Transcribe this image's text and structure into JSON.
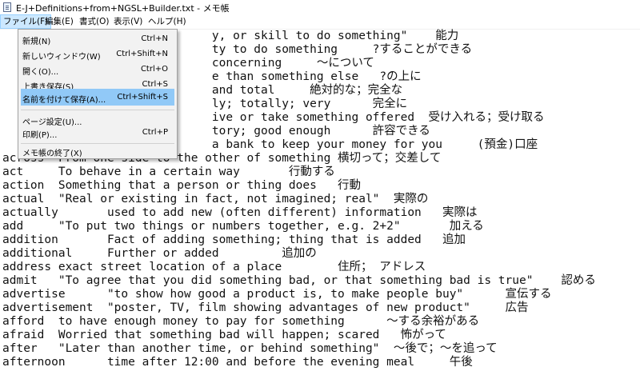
{
  "window": {
    "title": "E-J+Definitions+from+NGSL+Builder.txt - メモ帳"
  },
  "menubar": [
    {
      "label": "ファイル(F)",
      "active": true
    },
    {
      "label": "編集(E)"
    },
    {
      "label": "書式(O)"
    },
    {
      "label": "表示(V)"
    },
    {
      "label": "ヘルプ(H)"
    }
  ],
  "file_menu": {
    "groups": [
      [
        {
          "label": "新規(N)",
          "shortcut": "Ctrl+N"
        },
        {
          "label": "新しいウィンドウ(W)",
          "shortcut": "Ctrl+Shift+N"
        },
        {
          "label": "開く(O)...",
          "shortcut": "Ctrl+O"
        },
        {
          "label": "上書き保存(S)",
          "shortcut": "Ctrl+S"
        },
        {
          "label": "名前を付けて保存(A)...",
          "shortcut": "Ctrl+Shift+S",
          "highlighted": true
        }
      ],
      [
        {
          "label": "ページ設定(U)...",
          "shortcut": ""
        },
        {
          "label": "印刷(P)...",
          "shortcut": "Ctrl+P"
        }
      ],
      [
        {
          "label": "メモ帳の終了(X)",
          "shortcut": ""
        }
      ]
    ]
  },
  "editor": {
    "lines": [
      "                              y, or skill to do something\"    能力",
      "                              ty to do something     ?することができる",
      "                              concerning     ～について",
      "                              e than something else   ?の上に",
      "                              and total     絶対的な；完全な",
      "                              ly; totally; very      完全に",
      "                              ive or take something offered  受け入れる；受け取る",
      "                              tory; good enough      許容できる",
      "                              a bank to keep your money for you     (預金)口座",
      "across  From one side to the other of something 横切って；交差して",
      "act     To behave in a certain way       行動する",
      "action  Something that a person or thing does   行動",
      "actual  \"Real or existing in fact, not imagined; real\"  実際の",
      "actually       used to add new (often different) information   実際は",
      "add     \"To put two things or numbers together, e.g. 2+2\"       加える",
      "addition       Fact of adding something; thing that is added   追加",
      "additional     Further or added         追加の",
      "address exact street location of a place        住所； アドレス",
      "admit   \"To agree that you did something bad, or that something bad is true\"    認める",
      "advertise      \"to show how good a product is, to make people buy\"      宣伝する",
      "advertisement  \"poster, TV, film showing advantages of new product\"     広告",
      "afford  to have enough money to pay for something      ～する余裕がある",
      "afraid  Worried that something bad will happen; scared   怖がって",
      "after   \"Later than another time, or behind something\"  ～後で；～を追って",
      "afternoon      time after 12:00 and before the evening meal     午後"
    ]
  }
}
